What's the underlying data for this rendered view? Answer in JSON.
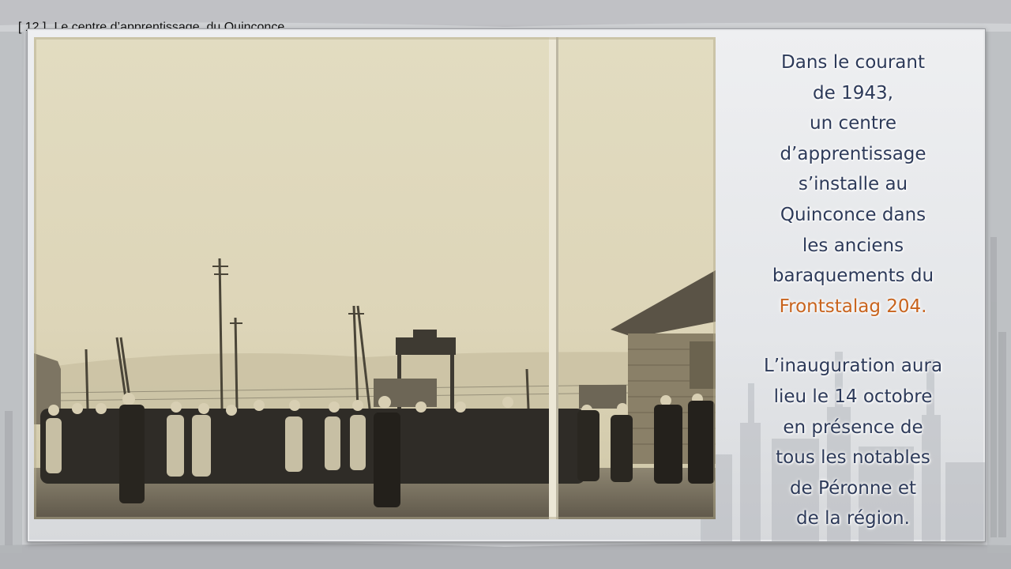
{
  "header": {
    "slide_number": "[ 12 ]",
    "title": "Le centre d’apprentissage  du Quinconce"
  },
  "photo": {
    "subject": "historic-photo"
  },
  "text": {
    "paragraph1": [
      "Dans le courant",
      "de 1943,",
      "un centre",
      "d’apprentissage",
      "s’installe au",
      "Quinconce dans",
      "les anciens",
      "baraquements du"
    ],
    "highlight": "Frontstalag 204.",
    "paragraph2": [
      "L’inauguration aura",
      "lieu le 14 octobre",
      "en présence de",
      "tous les notables",
      "de Péronne et",
      "de la région."
    ]
  },
  "colors": {
    "text": "#2d3a59",
    "accent": "#c8641e"
  }
}
